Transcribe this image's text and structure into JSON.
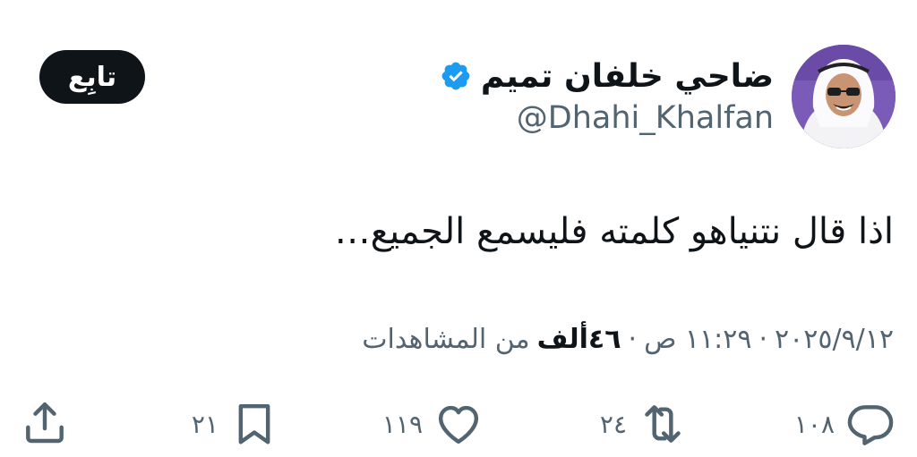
{
  "author": {
    "display_name": "ضاحي خلفان تميم",
    "handle": "@Dhahi_Khalfan",
    "verified": true
  },
  "follow_label": "تابِع",
  "tweet": {
    "text": "اذا قال نتنياهو كلمته فليسمع الجميع…"
  },
  "meta": {
    "date": "٢٠٢٥/٩/١٢",
    "separator": "·",
    "time": "١١:٢٩ ص",
    "views_count": "٤٦ألف",
    "views_label": "من المشاهدات"
  },
  "actions": {
    "replies": "١٠٨",
    "retweets": "٢٤",
    "likes": "١١٩",
    "bookmarks": "٢١"
  },
  "icons": {
    "verified": "verified-badge-icon",
    "reply": "reply-icon",
    "retweet": "retweet-icon",
    "like": "heart-icon",
    "bookmark": "bookmark-icon",
    "share": "share-icon"
  },
  "colors": {
    "verified_blue": "#1d9bf0",
    "text": "#0f1419",
    "secondary_text": "#536471",
    "follow_bg": "#0f1419"
  }
}
